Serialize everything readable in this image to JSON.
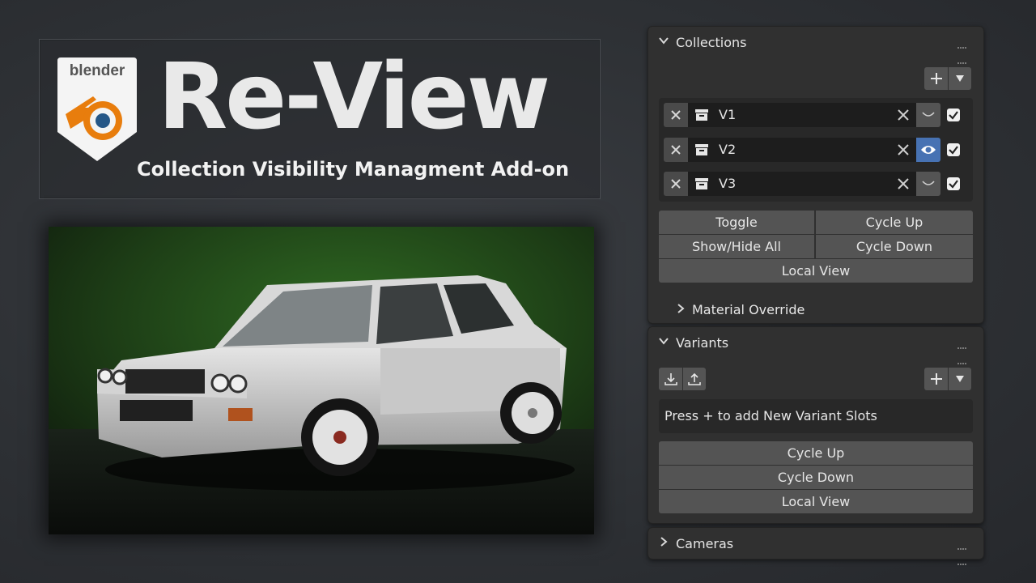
{
  "banner": {
    "logo_text": "blender",
    "title": "Re-View",
    "subtitle": "Collection Visibility Managment Add-on"
  },
  "collections_panel": {
    "header": "Collections",
    "rows": [
      {
        "name": "V1",
        "visible": false,
        "checked": true
      },
      {
        "name": "V2",
        "visible": true,
        "checked": true
      },
      {
        "name": "V3",
        "visible": false,
        "checked": true
      }
    ],
    "buttons": {
      "toggle": "Toggle",
      "cycle_up": "Cycle Up",
      "show_hide_all": "Show/Hide All",
      "cycle_down": "Cycle Down",
      "local_view": "Local View"
    },
    "subpanel": "Material Override"
  },
  "variants_panel": {
    "header": "Variants",
    "hint": "Press + to add New Variant Slots",
    "buttons": {
      "cycle_up": "Cycle Up",
      "cycle_down": "Cycle Down",
      "local_view": "Local View"
    }
  },
  "cameras_panel": {
    "header": "Cameras"
  },
  "colors": {
    "panel_bg": "#303030",
    "button_bg": "#545454",
    "active_blue": "#4772b3",
    "blender_orange": "#e87d0d",
    "blender_blue": "#265787"
  }
}
